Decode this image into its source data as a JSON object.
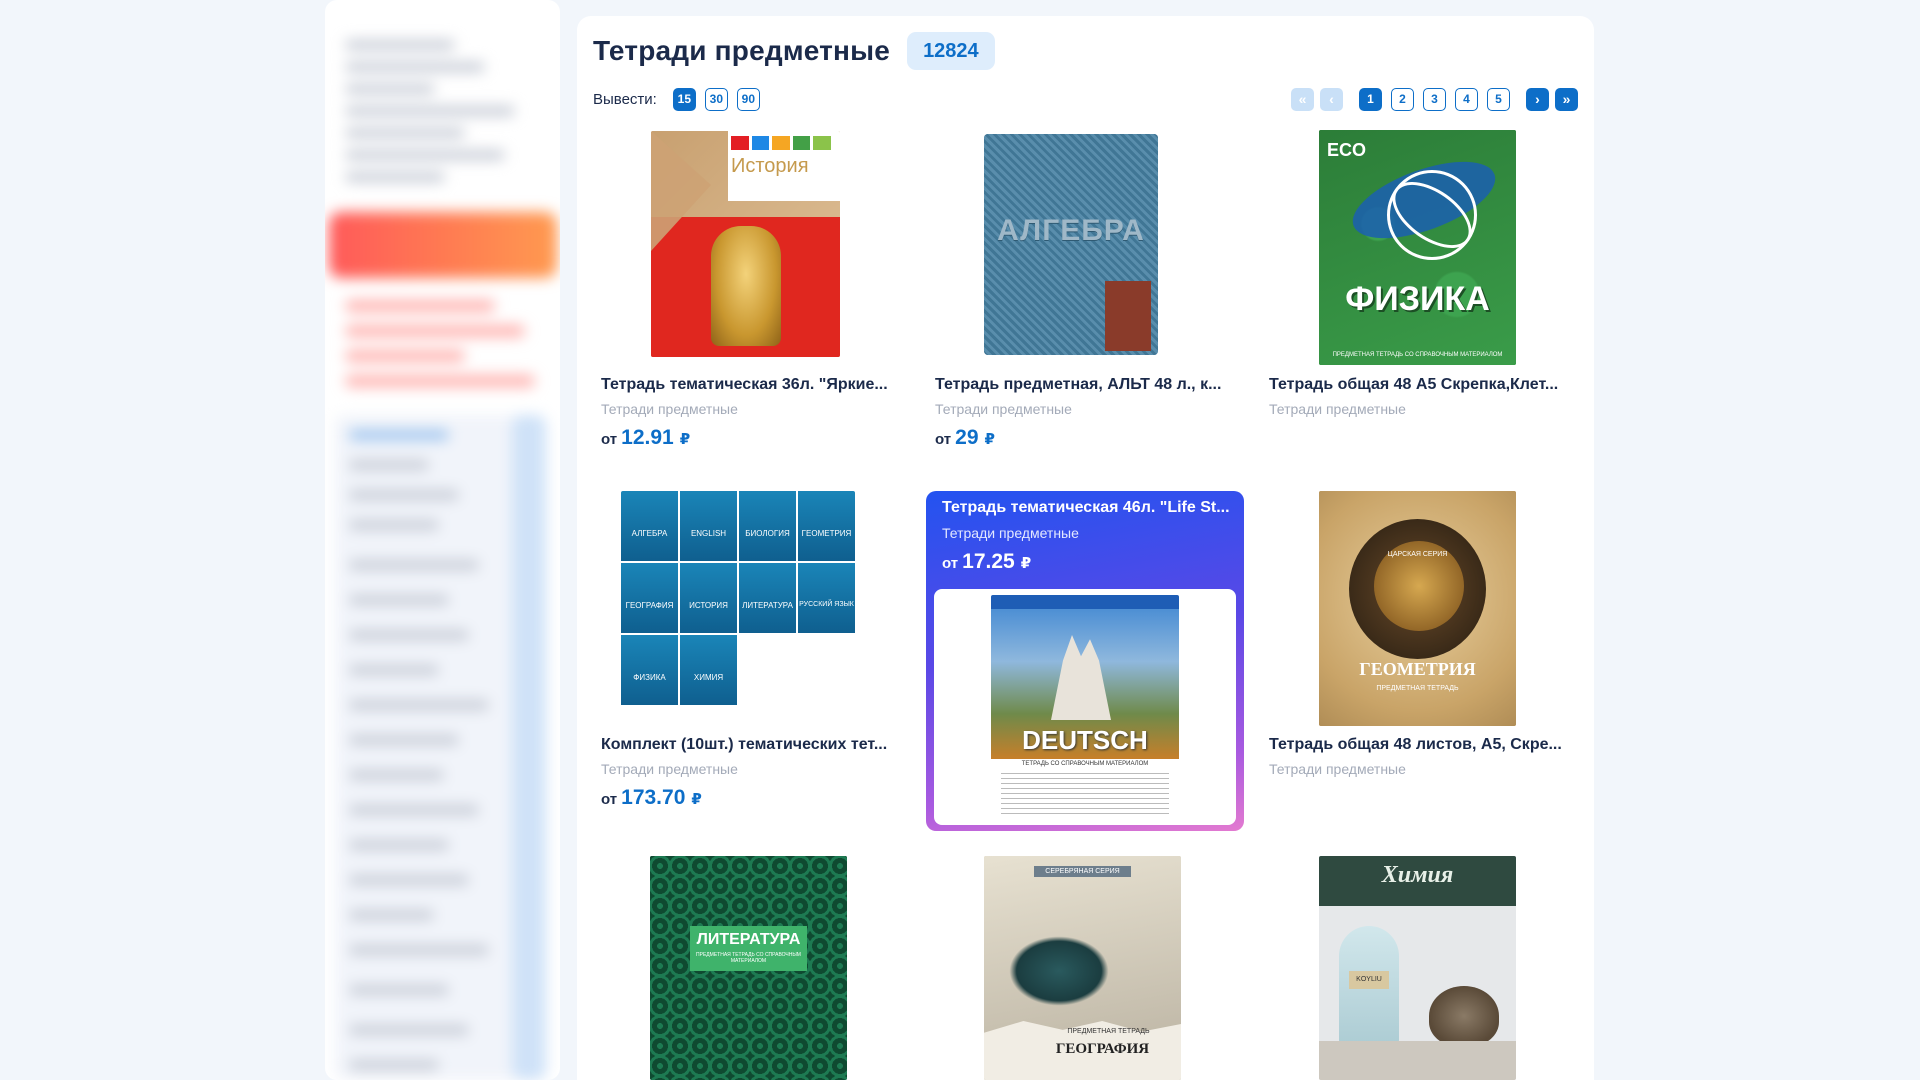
{
  "header": {
    "title": "Тетради предметные",
    "count": "12824"
  },
  "toolbar": {
    "show_label": "Вывести:",
    "per_page": [
      "15",
      "30",
      "90"
    ],
    "per_page_selected": "15"
  },
  "pagination": {
    "pages": [
      "1",
      "2",
      "3",
      "4",
      "5"
    ],
    "current": "1",
    "first_icon": "«",
    "prev_icon": "‹",
    "next_icon": "›",
    "last_icon": "»"
  },
  "products": [
    {
      "name": "Тетрадь тематическая 36л. \"Яркие...",
      "category": "Тетради предметные",
      "price_prefix": "от",
      "price": "12.91",
      "currency": "₽",
      "cover_text": "История"
    },
    {
      "name": "Тетрадь предметная, АЛЬТ 48 л., к...",
      "category": "Тетради предметные",
      "price_prefix": "от",
      "price": "29",
      "currency": "₽",
      "cover_text": "АЛГЕБРА"
    },
    {
      "name": "Тетрадь общая 48 А5 Скрепка,Клет...",
      "category": "Тетради предметные",
      "cover_text": "ФИЗИКА",
      "cover_sub": "ПРЕДМЕТНАЯ ТЕТРАДЬ СО СПРАВОЧНЫМ МАТЕРИАЛОМ",
      "cover_brand": "ECO"
    },
    {
      "name": "Комплект (10шт.) тематических тет...",
      "category": "Тетради предметные",
      "price_prefix": "от",
      "price": "173.70",
      "currency": "₽",
      "mini_covers": [
        "АЛГЕБРА",
        "ENGLISH",
        "БИОЛОГИЯ",
        "ГЕОМЕТРИЯ",
        "ГЕОГРАФИЯ",
        "ИСТОРИЯ",
        "ЛИТЕРАТУРА",
        "РУССКИЙ ЯЗЫК",
        "ФИЗИКА",
        "ХИМИЯ"
      ]
    },
    {
      "name": "Тетрадь тематическая 46л. \"Life St...",
      "category": "Тетради предметные",
      "price_prefix": "от",
      "price": "17.25",
      "currency": "₽",
      "cover_text": "DEUTSCH",
      "cover_sub": "ТЕТРАДЬ СО СПРАВОЧНЫМ МАТЕРИАЛОМ",
      "hovered": true
    },
    {
      "name": "Тетрадь общая 48 листов, А5, Скре...",
      "category": "Тетради предметные",
      "cover_text": "ГЕОМЕТРИЯ",
      "cover_sub": "ПРЕДМЕТНАЯ ТЕТРАДЬ",
      "cover_top": "ЦАРСКАЯ СЕРИЯ"
    },
    {
      "cover_text": "ЛИТЕРАТУРА",
      "cover_sub": "ПРЕДМЕТНАЯ ТЕТРАДЬ СО СПРАВОЧНЫМ МАТЕРИАЛОМ"
    },
    {
      "cover_text": "ГЕОГРАФИЯ",
      "cover_sub": "ПРЕДМЕТНАЯ ТЕТРАДЬ",
      "cover_top": "СЕРЕБРЯНАЯ СЕРИЯ"
    },
    {
      "cover_text": "Химия",
      "cover_label": "KOYLIU"
    }
  ],
  "colors": {
    "accent": "#0d6ec8",
    "badge_bg": "#deedfc",
    "hover_gradient_start": "#2353f0",
    "hover_gradient_end": "#e37ad0"
  }
}
